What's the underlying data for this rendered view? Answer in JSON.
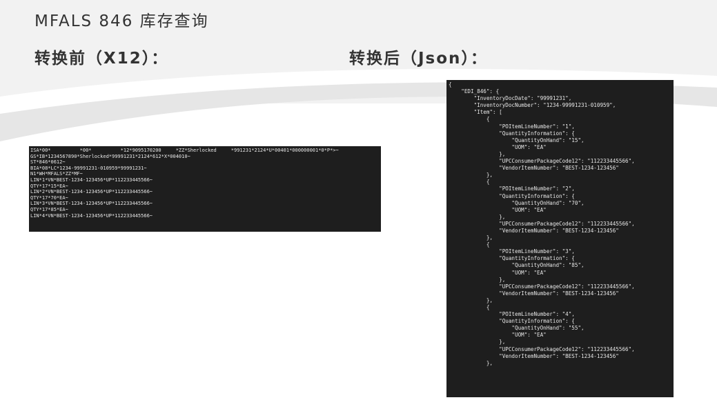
{
  "page_title": "MFALS 846 库存查询",
  "before_heading": "转换前（X12）：",
  "after_heading": "转换后（Json）：",
  "x12_lines": [
    "ISA*00*          *00*          *12*9095170200     *ZZ*Sherlocked     *991231*2124*U*00401*000000001*0*P*>~",
    "GS*IB*1234567890*Sherlocked*99991231*2124*612*X*004010~",
    "ST*846*0612~",
    "BIA*08*LC*1234-99991231-010959*99991231~",
    "N1*WH*MFALS*ZZ*MF~",
    "LIN*1*VN*BEST-1234-123456*UP*112233445566~",
    "QTY*17*15*EA~",
    "LIN*2*VN*BEST-1234-123456*UP*112233445566~",
    "QTY*17*70*EA~",
    "LIN*3*VN*BEST-1234-123456*UP*112233445566~",
    "QTY*17*85*EA~",
    "LIN*4*VN*BEST-1234-123456*UP*112233445566~"
  ],
  "json_lines": [
    "{",
    "    \"EDI_846\": {",
    "        \"InventoryDocDate\": \"99991231\",",
    "        \"InventoryDocNumber\": \"1234-99991231-010959\",",
    "        \"Item\": [",
    "            {",
    "                \"POItemLineNumber\": \"1\",",
    "                \"QuantityInformation\": {",
    "                    \"QuantityOnHand\": \"15\",",
    "                    \"UOM\": \"EA\"",
    "                },",
    "                \"UPCConsumerPackageCode12\": \"112233445566\",",
    "                \"VendorItemNumber\": \"BEST-1234-123456\"",
    "            },",
    "            {",
    "                \"POItemLineNumber\": \"2\",",
    "                \"QuantityInformation\": {",
    "                    \"QuantityOnHand\": \"70\",",
    "                    \"UOM\": \"EA\"",
    "                },",
    "                \"UPCConsumerPackageCode12\": \"112233445566\",",
    "                \"VendorItemNumber\": \"BEST-1234-123456\"",
    "            },",
    "            {",
    "                \"POItemLineNumber\": \"3\",",
    "                \"QuantityInformation\": {",
    "                    \"QuantityOnHand\": \"85\",",
    "                    \"UOM\": \"EA\"",
    "                },",
    "                \"UPCConsumerPackageCode12\": \"112233445566\",",
    "                \"VendorItemNumber\": \"BEST-1234-123456\"",
    "            },",
    "            {",
    "                \"POItemLineNumber\": \"4\",",
    "                \"QuantityInformation\": {",
    "                    \"QuantityOnHand\": \"55\",",
    "                    \"UOM\": \"EA\"",
    "                },",
    "                \"UPCConsumerPackageCode12\": \"112233445566\",",
    "                \"VendorItemNumber\": \"BEST-1234-123456\"",
    "            },"
  ]
}
